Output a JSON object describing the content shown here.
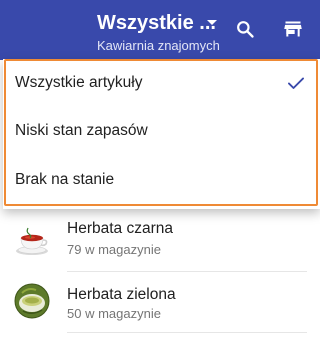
{
  "appbar": {
    "title": "Wszystkie ...",
    "subtitle": "Kawiarnia znajomych",
    "background": "#3949ab",
    "icons": [
      "search-icon",
      "store-icon",
      "dropdown-caret-icon"
    ]
  },
  "filter_menu": {
    "items": [
      {
        "label": "Wszystkie artykuły",
        "selected": true
      },
      {
        "label": "Niski stan zapasów",
        "selected": false
      },
      {
        "label": "Brak na stanie",
        "selected": false
      }
    ],
    "accent": "#3949ab",
    "highlight_color": "#ef8a35"
  },
  "inventory": {
    "items": [
      {
        "name": "Herbata czarna",
        "stock": "79 w magazynie",
        "icon": "black-tea-image"
      },
      {
        "name": "Herbata zielona",
        "stock": "50 w magazynie",
        "icon": "green-tea-image"
      }
    ]
  }
}
